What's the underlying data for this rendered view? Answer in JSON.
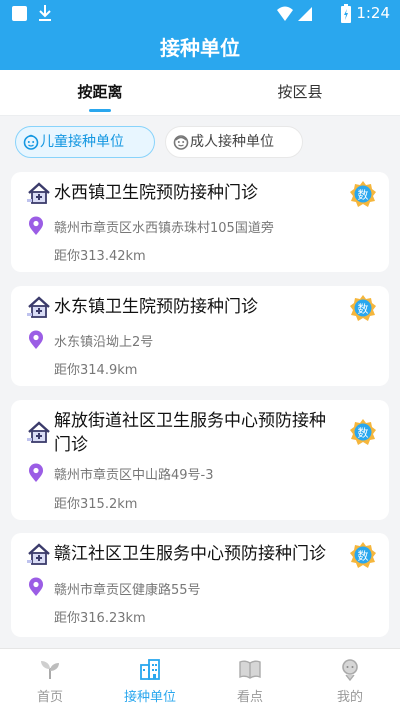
{
  "status_bar": {
    "time": "1:24"
  },
  "title": "接种单位",
  "tabs": [
    {
      "label": "按距离",
      "active": true
    },
    {
      "label": "按区县",
      "active": false
    }
  ],
  "filter_chips": [
    {
      "label": "儿童接种单位",
      "icon": "child-face-icon",
      "active": true
    },
    {
      "label": "成人接种单位",
      "icon": "adult-face-icon",
      "active": false
    }
  ],
  "clinics": [
    {
      "name": "水西镇卫生院预防接种门诊",
      "address": "赣州市章贡区水西镇赤珠村105国道旁",
      "distance": "距你313.42km",
      "badge": "数"
    },
    {
      "name": "水东镇卫生院预防接种门诊",
      "address": "水东镇沿坳上2号",
      "distance": "距你314.9km",
      "badge": "数"
    },
    {
      "name": "解放街道社区卫生服务中心预防接种门诊",
      "address": "赣州市章贡区中山路49号-3",
      "distance": "距你315.2km",
      "badge": "数"
    },
    {
      "name": "赣江社区卫生服务中心预防接种门诊",
      "address": "赣州市章贡区健康路55号",
      "distance": "距你316.23km",
      "badge": "数"
    }
  ],
  "bottom_nav": [
    {
      "label": "首页",
      "icon": "sprout-icon",
      "active": false
    },
    {
      "label": "接种单位",
      "icon": "building-icon",
      "active": true
    },
    {
      "label": "看点",
      "icon": "book-icon",
      "active": false
    },
    {
      "label": "我的",
      "icon": "profile-icon",
      "active": false
    }
  ],
  "colors": {
    "primary": "#2aa7ee",
    "badge": "#f5b63c",
    "pin": "#9b5de5"
  }
}
